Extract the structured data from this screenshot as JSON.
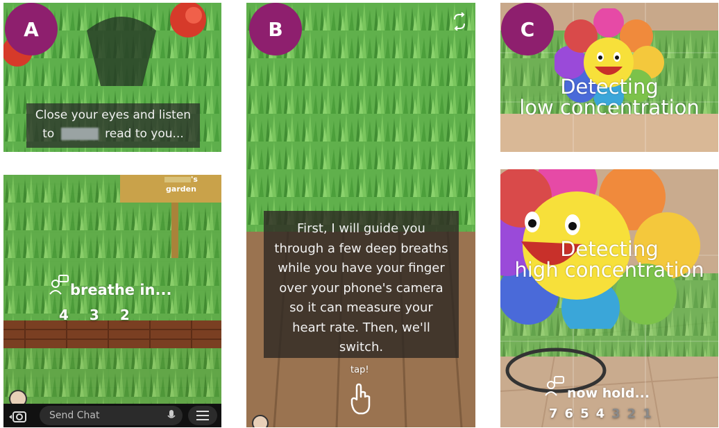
{
  "panels": {
    "a_top": {
      "badge": "A",
      "caption_line1": "Close your eyes and listen",
      "caption_to": "to",
      "caption_rest": "read to you..."
    },
    "a_bottom": {
      "sign_suffix": "'s",
      "sign_garden": "garden",
      "breathe": "breathe in...",
      "counts": [
        "4",
        "3",
        "2"
      ],
      "chat_placeholder": "Send Chat"
    },
    "b": {
      "badge": "B",
      "message": "First, I will guide you through a few deep breaths while you have your finger over your phone's camera so it can measure your heart rate. Then, we'll switch.",
      "tap": "tap!"
    },
    "c_top": {
      "badge": "C",
      "line1": "Detecting",
      "line2": "low concentration"
    },
    "c_bottom": {
      "line1": "Detecting",
      "line2": "high concentration",
      "hold": "now hold...",
      "counts_active": [
        "7",
        "6",
        "5",
        "4"
      ],
      "counts_dim": [
        "3",
        "2",
        "1"
      ]
    }
  },
  "colors": {
    "badge": "#8e1f6e",
    "grass": "#5cb84a"
  }
}
